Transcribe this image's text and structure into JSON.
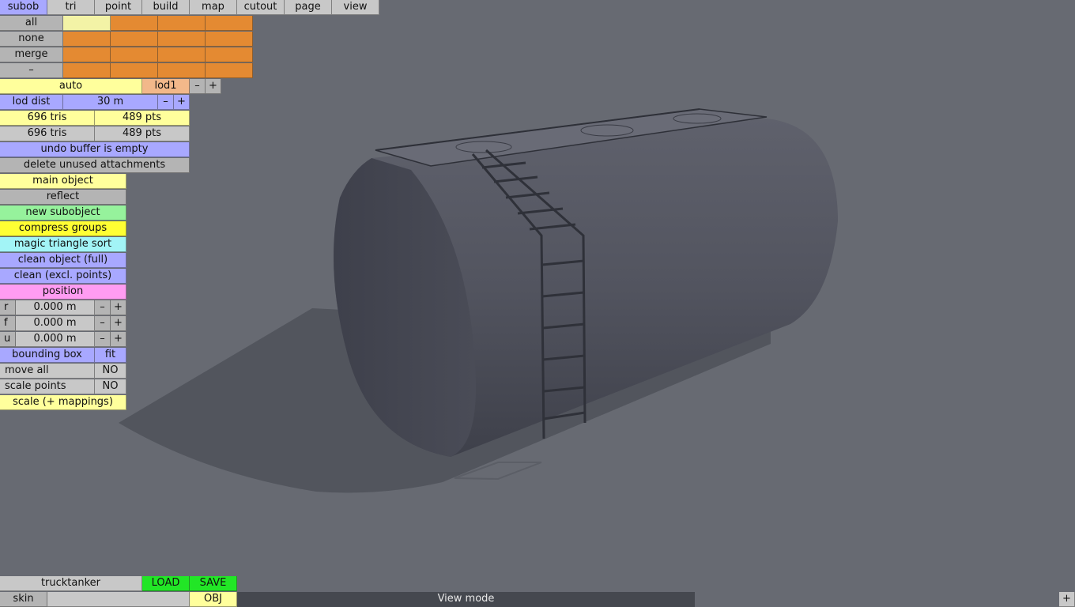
{
  "top_menu": [
    "subob",
    "tri",
    "point",
    "build",
    "map",
    "cutout",
    "page",
    "view"
  ],
  "selection": {
    "all": "all",
    "none": "none",
    "merge": "merge",
    "minus": "–"
  },
  "lod": {
    "auto": "auto",
    "current": "lod1",
    "minus": "–",
    "plus": "+"
  },
  "lod_dist": {
    "label": "lod dist",
    "value": "30 m",
    "minus": "–",
    "plus": "+"
  },
  "stats": [
    {
      "tris": "696 tris",
      "pts": "489 pts"
    },
    {
      "tris": "696 tris",
      "pts": "489 pts"
    }
  ],
  "undo_status": "undo buffer is empty",
  "actions": {
    "delete_unused": "delete unused attachments",
    "main_object": "main object",
    "reflect": "reflect",
    "new_subobject": "new subobject",
    "compress_groups": "compress groups",
    "magic_sort": "magic triangle sort",
    "clean_full": "clean object (full)",
    "clean_excl": "clean (excl. points)"
  },
  "position": {
    "title": "position",
    "rows": [
      {
        "axis": "r",
        "value": "0.000 m",
        "minus": "–",
        "plus": "+"
      },
      {
        "axis": "f",
        "value": "0.000 m",
        "minus": "–",
        "plus": "+"
      },
      {
        "axis": "u",
        "value": "0.000 m",
        "minus": "–",
        "plus": "+"
      }
    ]
  },
  "bounding_box": {
    "label": "bounding box",
    "fit": "fit"
  },
  "move_all": {
    "label": "move all",
    "value": "NO"
  },
  "scale_points": {
    "label": "scale points",
    "value": "NO"
  },
  "scale_mappings": "scale (+ mappings)",
  "file": {
    "name": "trucktanker",
    "load": "LOAD",
    "save": "SAVE"
  },
  "skin": {
    "label": "skin",
    "value": "",
    "obj": "OBJ"
  },
  "status_text": "View mode",
  "corner_plus": "+"
}
